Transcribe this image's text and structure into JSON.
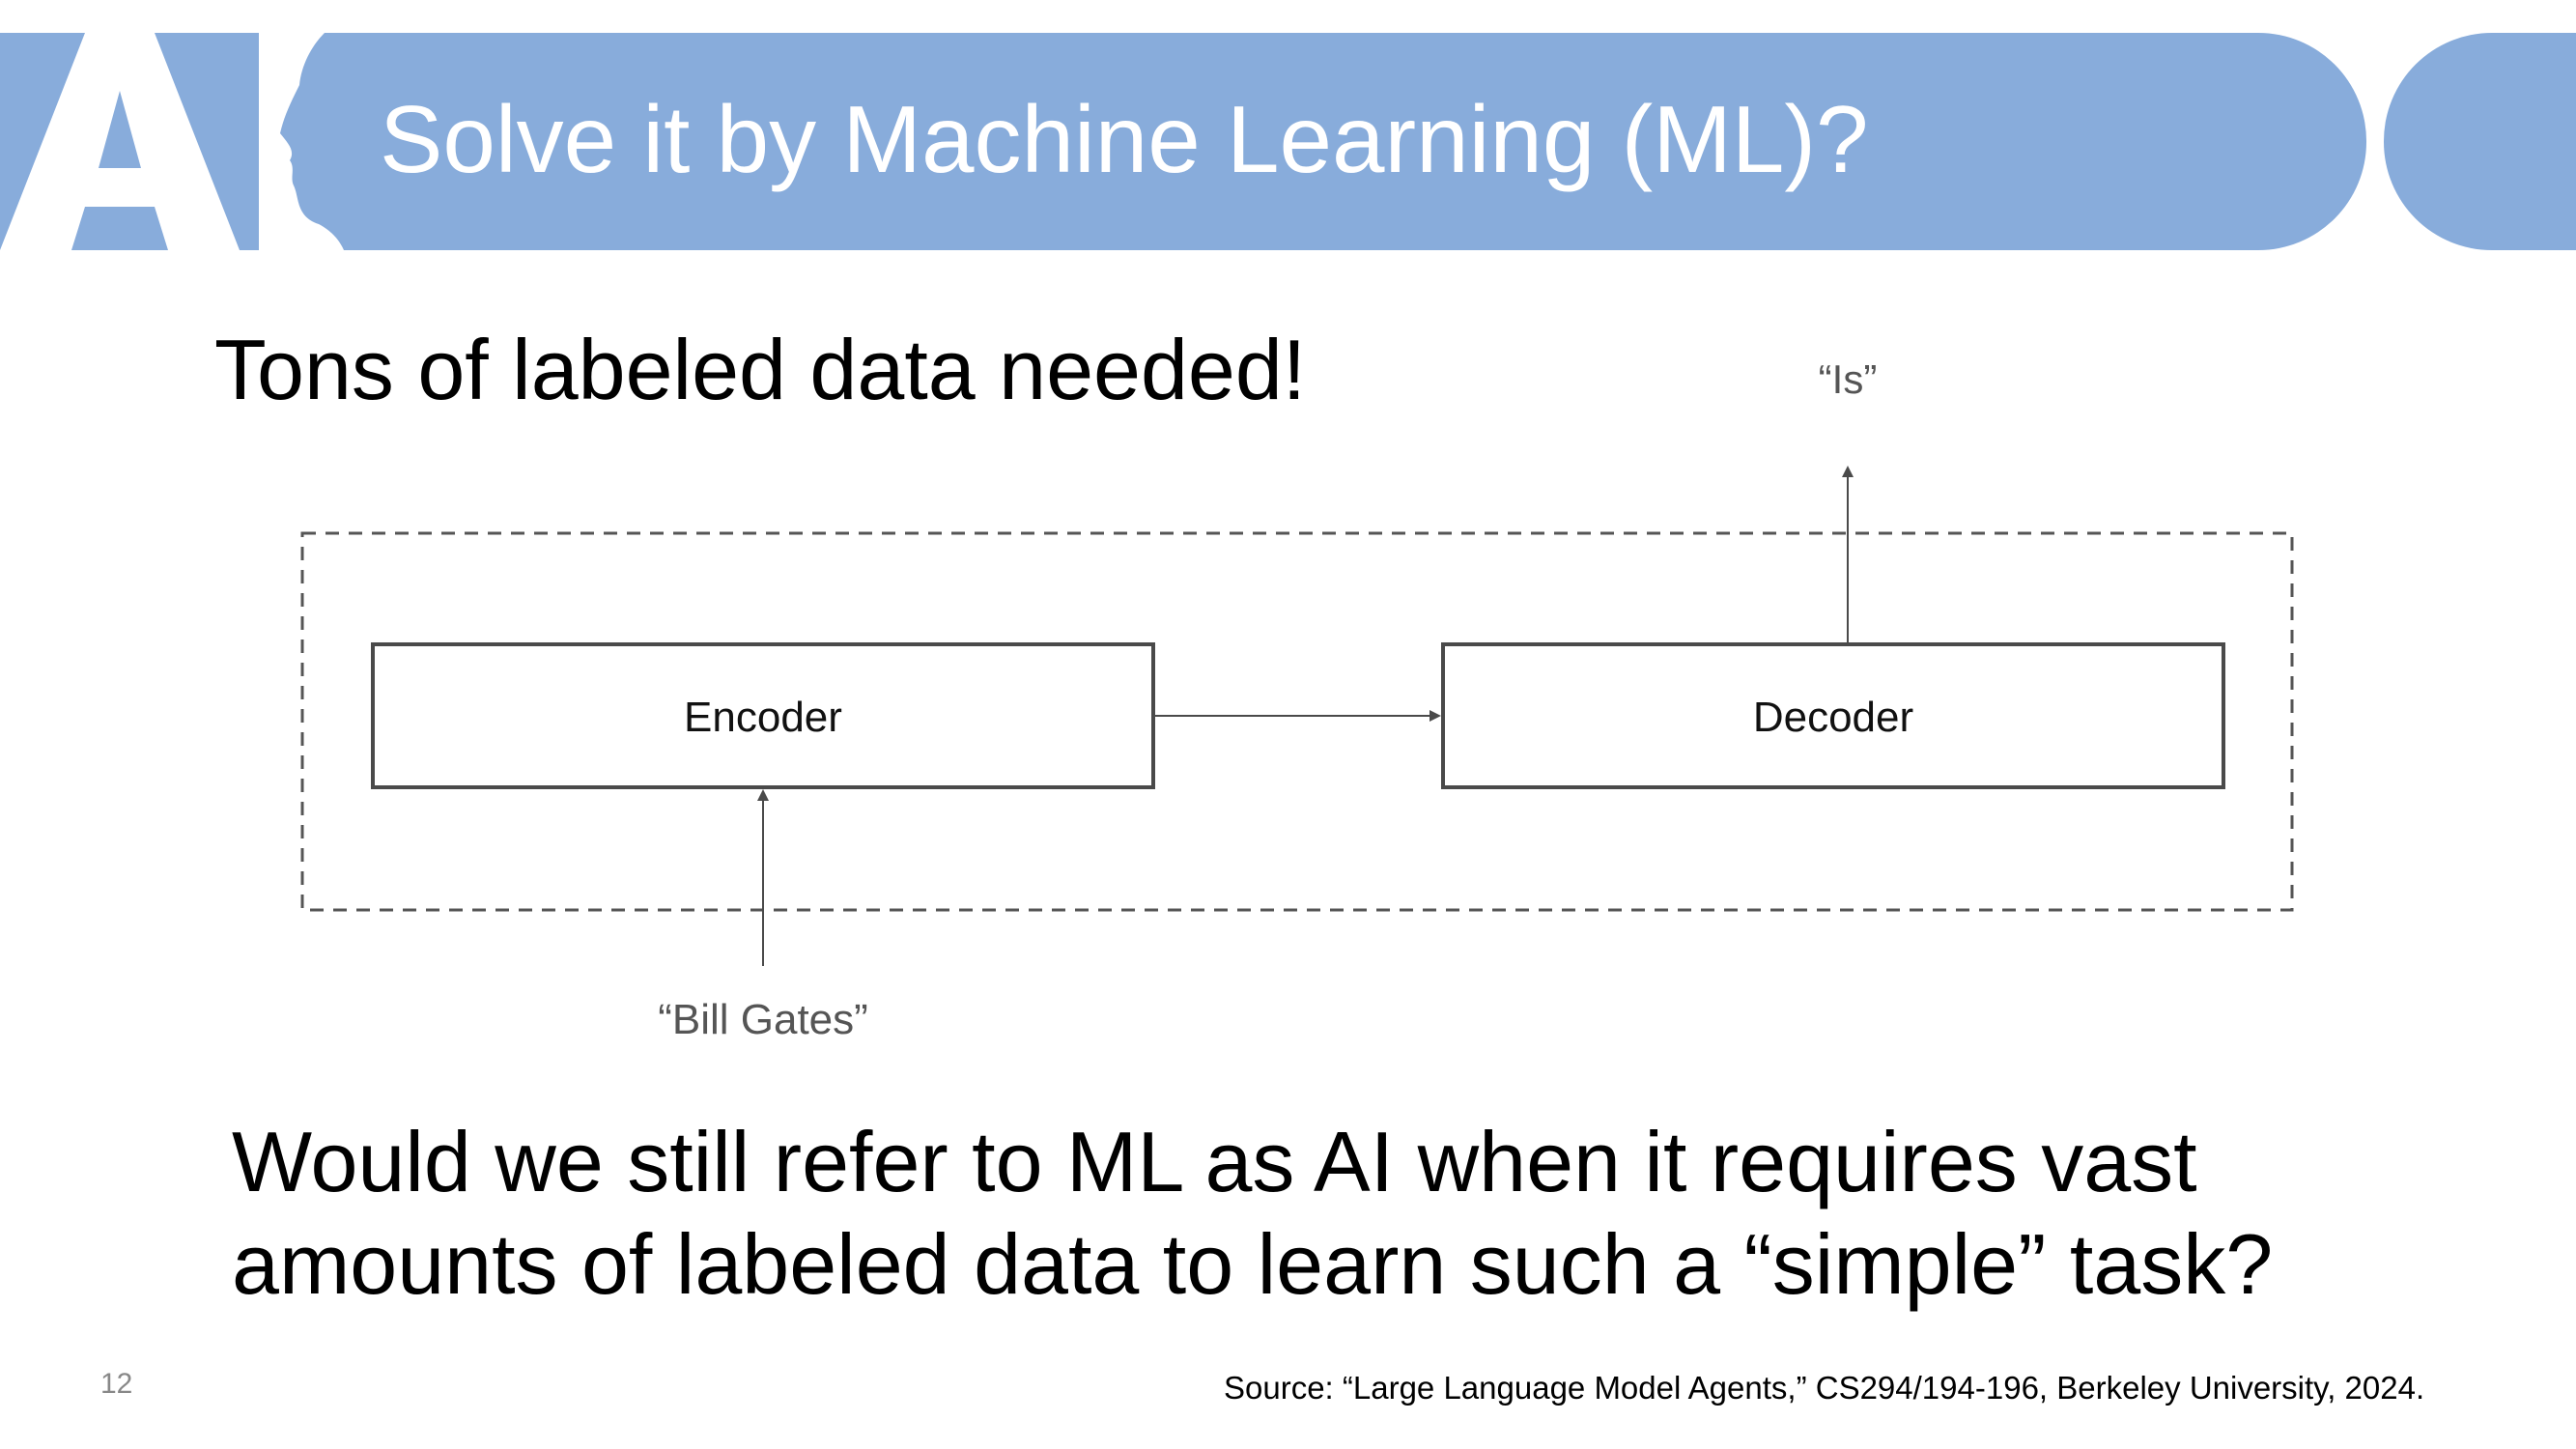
{
  "slide": {
    "title": "Solve it by Machine Learning (ML)?",
    "subtitle": "Tons of labeled data needed!",
    "question_line1": "Would we still refer to ML as AI when it requires vast",
    "question_line2": "amounts of labeled data to learn such a “simple” task?",
    "page_number": "12",
    "source": "Source: “Large Language Model Agents,” CS294/194-196, Berkeley University, 2024."
  },
  "logo": {
    "text": "AI",
    "icon": "ai-head-silhouette-logo"
  },
  "diagram": {
    "encoder_label": "Encoder",
    "decoder_label": "Decoder",
    "input_label": "“Bill Gates”",
    "output_label": "“Is”"
  },
  "colors": {
    "header_blue": "#88acdb",
    "title_text": "#ffffff",
    "box_stroke": "#4a4a4a",
    "secondary_text": "#555555"
  }
}
